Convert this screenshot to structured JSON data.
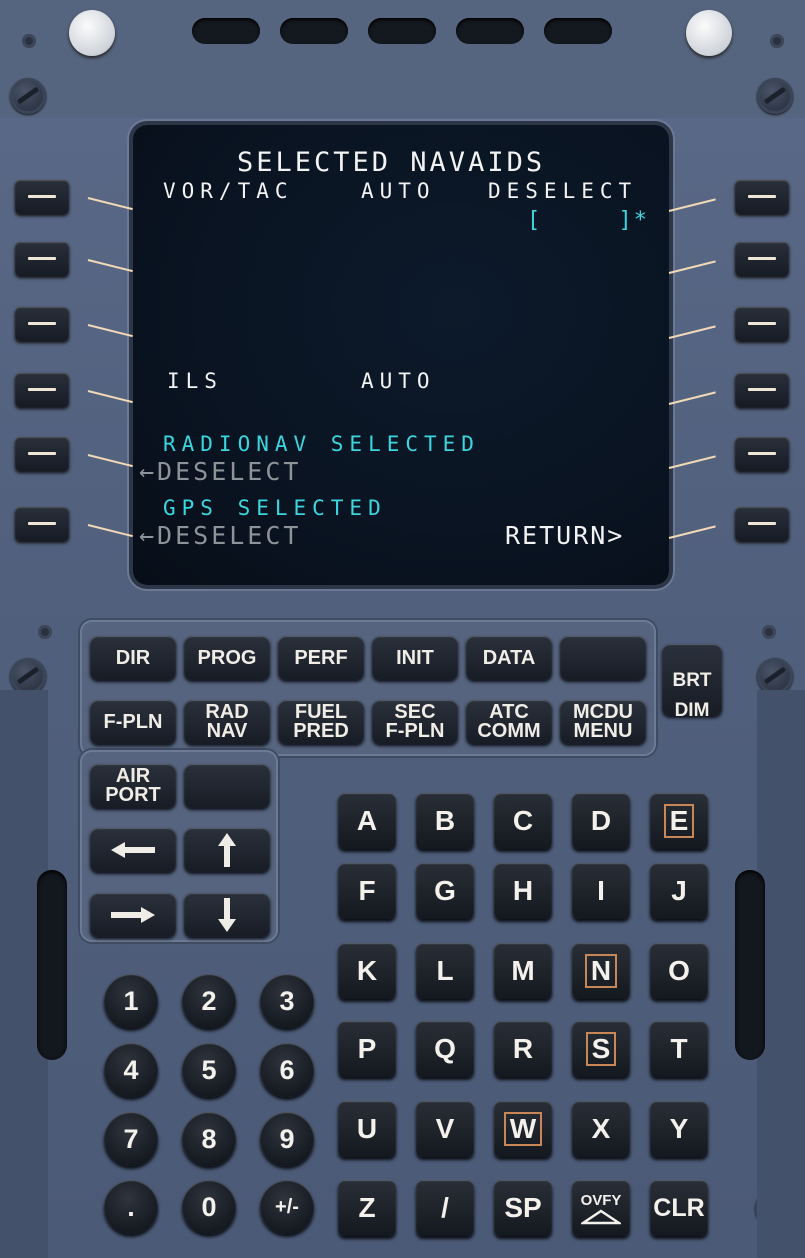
{
  "screen": {
    "title": "SELECTED NAVAIDS",
    "row1_left": "VOR/TAC",
    "row1_mid": "AUTO",
    "row1_right": "DESELECT",
    "row1b_right": "[     ]*",
    "ils_label": "ILS",
    "ils_mode": "AUTO",
    "radionav_selected": "RADIONAV SELECTED",
    "radionav_deselect": "←DESELECT",
    "gps_selected": "GPS SELECTED",
    "gps_deselect": "←DESELECT",
    "return": "RETURN>"
  },
  "function_keys": {
    "dir": "DIR",
    "prog": "PROG",
    "perf": "PERF",
    "init": "INIT",
    "data": "DATA",
    "fpln": "F-PLN",
    "radnav": "RAD\nNAV",
    "fuelpred": "FUEL\nPRED",
    "secfpln": "SEC\nF-PLN",
    "atccomm": "ATC\nCOMM",
    "mcdumenu": "MCDU\nMENU",
    "airport": "AIR\nPORT",
    "brt": "BRT",
    "dim": "DIM"
  },
  "alpha_keys": [
    "A",
    "B",
    "C",
    "D",
    "E",
    "F",
    "G",
    "H",
    "I",
    "J",
    "K",
    "L",
    "M",
    "N",
    "O",
    "P",
    "Q",
    "R",
    "S",
    "T",
    "U",
    "V",
    "W",
    "X",
    "Y",
    "Z",
    "/",
    "SP",
    "OVFY",
    "CLR"
  ],
  "num_keys": [
    "1",
    "2",
    "3",
    "4",
    "5",
    "6",
    "7",
    "8",
    "9",
    ".",
    "0",
    "+/-"
  ],
  "colors": {
    "white": "#f3f3f3",
    "cyan": "#3bd6de",
    "gray": "#8e9399",
    "lsk_line": "#f2d9b8",
    "boxed_key": "#c98656"
  }
}
